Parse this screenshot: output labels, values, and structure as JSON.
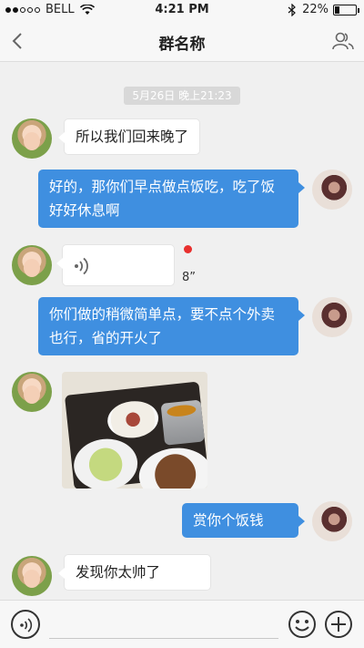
{
  "status_bar": {
    "carrier": "BELL",
    "time": "4:21 PM",
    "battery": "22%",
    "battery_level": 0.22,
    "signal_bars": 2
  },
  "nav": {
    "title": "群名称",
    "back_icon": "chevron-left-icon",
    "members_icon": "group-members-icon"
  },
  "chat": {
    "timestamp": "5月26日 晚上21:23",
    "messages": [
      {
        "from": "other",
        "type": "text",
        "text": "所以我们回来晚了"
      },
      {
        "from": "self",
        "type": "text",
        "text": "好的，那你们早点做点饭吃，吃了饭好好休息啊"
      },
      {
        "from": "other",
        "type": "voice",
        "duration": "8”",
        "unread": true
      },
      {
        "from": "self",
        "type": "text",
        "text": "你们做的稍微简单点，要不点个外卖也行，省的开火了"
      },
      {
        "from": "other",
        "type": "image",
        "image": "food-tray-photo"
      },
      {
        "from": "self",
        "type": "text",
        "text": "赏你个饭钱"
      },
      {
        "from": "other",
        "type": "text",
        "text": "发现你太帅了"
      }
    ]
  },
  "input_bar": {
    "placeholder": "",
    "voice_icon": "voice-input-icon",
    "emoji_icon": "emoji-icon",
    "plus_icon": "plus-icon"
  },
  "colors": {
    "outgoing_bubble": "#3f8fe0",
    "unread_dot": "#e8302e",
    "background": "#f0f0f0"
  }
}
